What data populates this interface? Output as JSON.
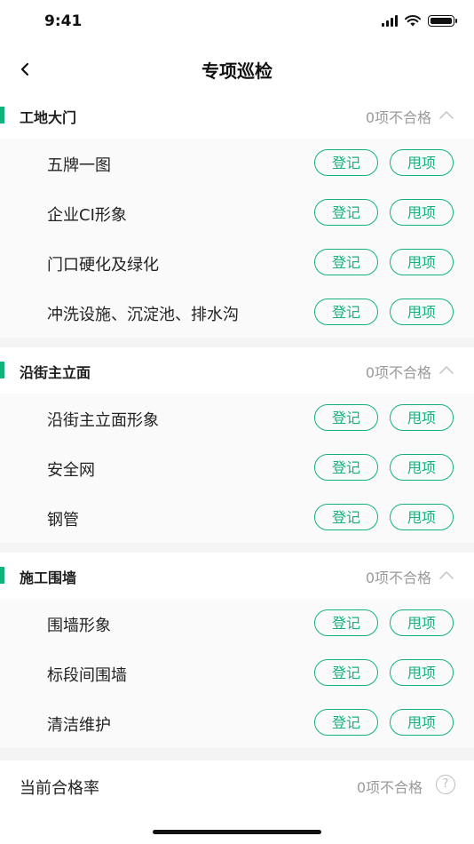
{
  "status_bar": {
    "time": "9:41"
  },
  "nav": {
    "title": "专项巡检"
  },
  "sections": [
    {
      "title": "工地大门",
      "status": "0项不合格",
      "items": [
        {
          "label": "五牌一图",
          "register_label": "登记",
          "assign_label": "甩项"
        },
        {
          "label": "企业CI形象",
          "register_label": "登记",
          "assign_label": "甩项"
        },
        {
          "label": "门口硬化及绿化",
          "register_label": "登记",
          "assign_label": "甩项"
        },
        {
          "label": "冲洗设施、沉淀池、排水沟",
          "register_label": "登记",
          "assign_label": "甩项"
        }
      ]
    },
    {
      "title": "沿街主立面",
      "status": "0项不合格",
      "items": [
        {
          "label": "沿街主立面形象",
          "register_label": "登记",
          "assign_label": "甩项"
        },
        {
          "label": "安全网",
          "register_label": "登记",
          "assign_label": "甩项"
        },
        {
          "label": "钢管",
          "register_label": "登记",
          "assign_label": "甩项"
        }
      ]
    },
    {
      "title": "施工围墙",
      "status": "0项不合格",
      "items": [
        {
          "label": "围墙形象",
          "register_label": "登记",
          "assign_label": "甩项"
        },
        {
          "label": "标段间围墙",
          "register_label": "登记",
          "assign_label": "甩项"
        },
        {
          "label": "清洁维护",
          "register_label": "登记",
          "assign_label": "甩项"
        }
      ]
    }
  ],
  "footer": {
    "label": "当前合格率",
    "status": "0项不合格",
    "help_glyph": "?"
  },
  "colors": {
    "accent": "#13b27b",
    "muted": "#9a9a9a"
  }
}
